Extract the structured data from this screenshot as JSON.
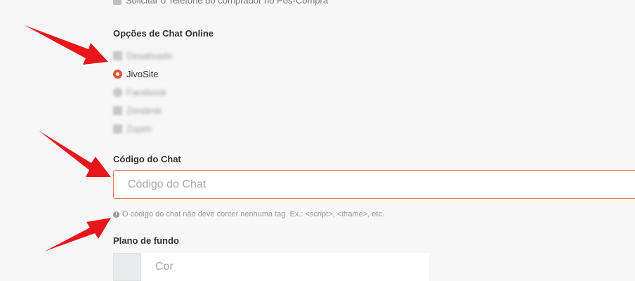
{
  "top_option": {
    "label": "Solicitar o Telefone do comprador no Pós-Compra"
  },
  "chat_options": {
    "title": "Opções de Chat Online",
    "items": [
      {
        "label": "Desativado",
        "selected": false,
        "blurred": true
      },
      {
        "label": "JivoSite",
        "selected": true,
        "blurred": false
      },
      {
        "label": "Facebook",
        "selected": false,
        "blurred": true
      },
      {
        "label": "Zendesk",
        "selected": false,
        "blurred": true
      },
      {
        "label": "Zopim",
        "selected": false,
        "blurred": true
      }
    ]
  },
  "chat_code": {
    "title": "Código do Chat",
    "placeholder": "Código do Chat",
    "value": "",
    "hint": "O código do chat não deve conter nenhuma tag. Ex.: <script>, <iframe>, etc."
  },
  "background": {
    "title": "Plano de fundo",
    "placeholder": "Cor"
  },
  "colors": {
    "accent": "#e2573a",
    "arrow": "#e8161b"
  }
}
